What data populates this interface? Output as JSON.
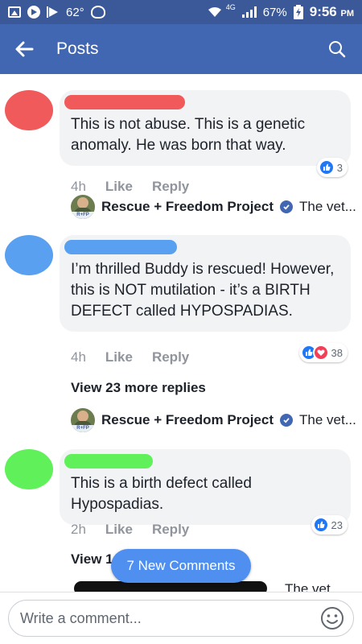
{
  "status_bar": {
    "temperature": "62°",
    "network": "4G",
    "battery": "67%",
    "time": "9:56",
    "ampm": "PM"
  },
  "header": {
    "title": "Posts"
  },
  "comments": [
    {
      "text": "This is not abuse. This is a genetic anomaly. He was born that way.",
      "time": "4h",
      "like_label": "Like",
      "reply_label": "Reply",
      "reaction_count": "3",
      "avatar_color": "#f05a5a"
    },
    {
      "text": "I’m thrilled Buddy is rescued! However, this is NOT mutilation - it’s a BIRTH DEFECT called HYPOSPADIAS.",
      "time": "4h",
      "like_label": "Like",
      "reply_label": "Reply",
      "reaction_count": "38",
      "avatar_color": "#5aa0f0"
    },
    {
      "text": "This is a birth defect called Hypospadias.",
      "time": "2h",
      "like_label": "Like",
      "reply_label": "Reply",
      "reaction_count": "23",
      "avatar_color": "#5ff05a"
    }
  ],
  "page_replies": [
    {
      "avatar_tag": "R+FP",
      "name": "Rescue + Freedom Project",
      "snippet": "The vet..."
    },
    {
      "avatar_tag": "R+FP",
      "name": "Rescue + Freedom Project",
      "snippet": "The vet..."
    }
  ],
  "view_more": {
    "label": "View 23 more replies",
    "partial_label": "View 1"
  },
  "new_comments_label": "7 New Comments",
  "partial_snippet": "The vet",
  "composer": {
    "placeholder": "Write a comment..."
  },
  "colors": {
    "status_bar": "#3b5998",
    "app_bar": "#4267b2",
    "bubble": "#f2f3f5",
    "like_blue": "#2078f4",
    "love_red": "#f33e58"
  },
  "icons": {
    "back": "arrow-left-icon",
    "search": "search-icon",
    "emoji": "smiley-icon",
    "verified": "verified-badge-icon"
  }
}
